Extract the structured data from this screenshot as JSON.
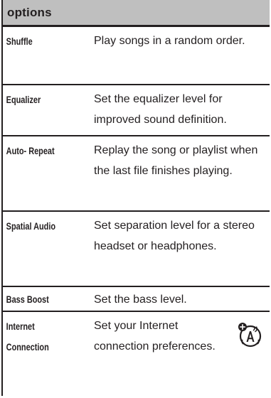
{
  "header": {
    "title": "options"
  },
  "rows": [
    {
      "name": "Shuffle",
      "desc": "Play songs in a random order."
    },
    {
      "name": "Equalizer",
      "desc": "Set the equalizer level for improved sound definition."
    },
    {
      "name": "Auto- Repeat",
      "desc": "Replay the song or playlist when the last file finishes playing."
    },
    {
      "name": "Spatial Audio",
      "desc": "Set separation level for a stereo headset or headphones."
    },
    {
      "name": "Bass Boost",
      "desc": "Set the bass level."
    },
    {
      "name": "Internet Connection",
      "desc": "Set your Internet connection preferences."
    }
  ],
  "icons": {
    "network_feature": "network-accessory-icon"
  }
}
